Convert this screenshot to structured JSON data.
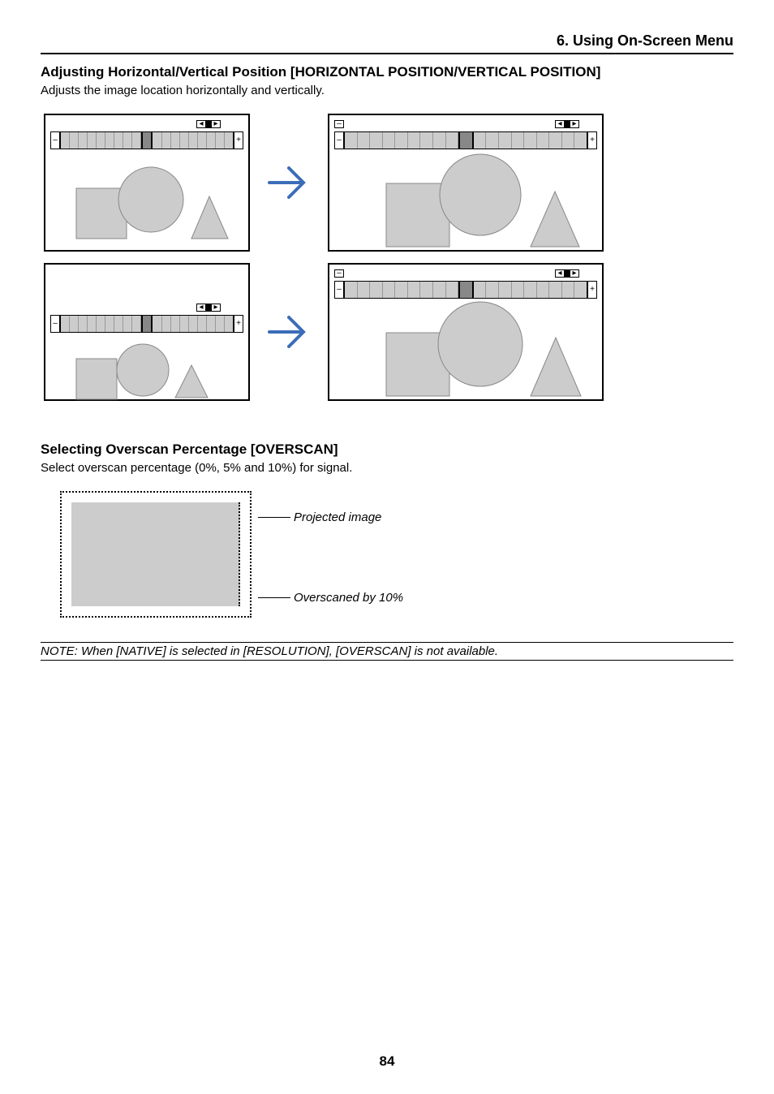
{
  "header": {
    "section": "6. Using On-Screen Menu"
  },
  "section1": {
    "title": "Adjusting Horizontal/Vertical Position [HORIZONTAL POSITION/VERTICAL POSITION]",
    "desc": "Adjusts the image location horizontally and vertically."
  },
  "section2": {
    "title": "Selecting Overscan Percentage [OVERSCAN]",
    "desc": "Select overscan percentage (0%, 5% and 10%) for signal."
  },
  "overscan": {
    "label1": "Projected image",
    "label2": "Overscaned by 10%"
  },
  "note": "NOTE: When [NATIVE] is selected in [RESOLUTION], [OVERSCAN] is not available.",
  "page_number": "84"
}
